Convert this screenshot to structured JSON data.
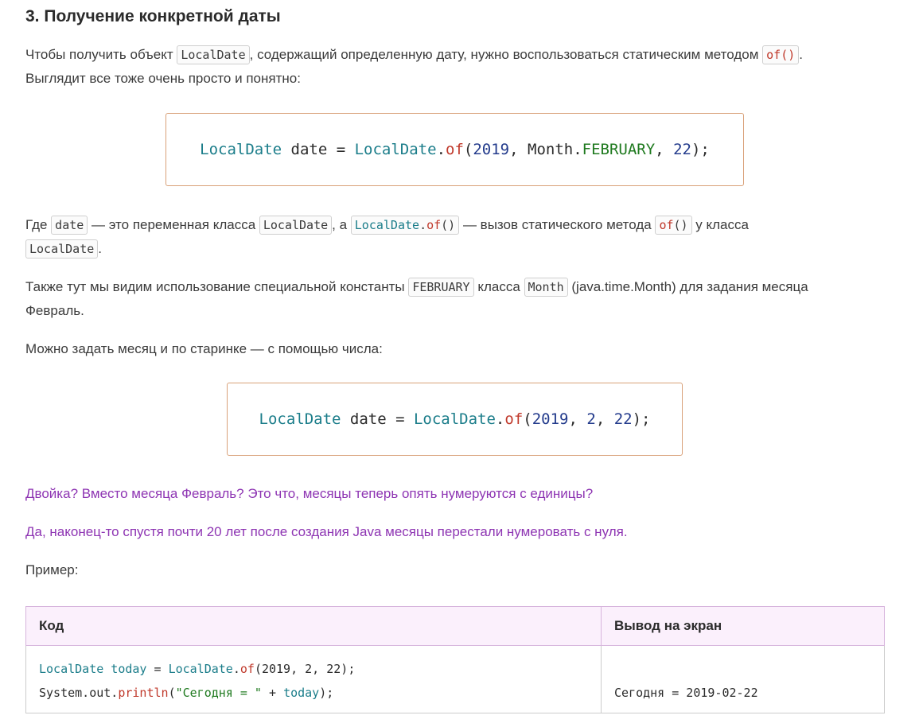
{
  "section": {
    "title": "3. Получение конкретной даты"
  },
  "intro": {
    "text_1": "Чтобы получить объект ",
    "code_localdate": "LocalDate",
    "text_2": ", содержащий определенную дату, нужно воспользоваться статическим методом ",
    "code_of": "of()",
    "text_3": ".",
    "line_2": "Выглядит все тоже очень просто и понятно:"
  },
  "code_block_1": {
    "type_name": "LocalDate",
    "var_name": " date = ",
    "class_ref": "LocalDate",
    "dot": ".",
    "method": "of",
    "open": "(",
    "year": "2019",
    "sep_1": ", ",
    "month_class": "Month.",
    "month_const": "FEBRUARY",
    "sep_2": ", ",
    "day": "22",
    "close": ");"
  },
  "explanation": {
    "text_1": "Где ",
    "code_date": "date",
    "text_2": " — это переменная класса ",
    "code_localdate": "LocalDate",
    "text_3": ", а ",
    "code_call_class": "LocalDate",
    "code_call_dot": ".",
    "code_call_method": "of",
    "code_call_parens": "()",
    "text_4": " — вызов статического метода ",
    "code_of_method": "of",
    "code_of_parens": "()",
    "text_5": " у класса",
    "code_localdate_2": "LocalDate",
    "text_6": "."
  },
  "constant_note": {
    "text_1": "Также тут мы видим использование специальной константы ",
    "code_february": "FEBRUARY",
    "text_2": " класса ",
    "code_month": "Month",
    "text_3": " (java.time.Month) для задания месяца",
    "line_2": "Февраль."
  },
  "numeric_month_note": {
    "text": "Можно задать месяц и по старинке — с помощью числа:"
  },
  "code_block_2": {
    "type_name": "LocalDate",
    "var_name": " date = ",
    "class_ref": "LocalDate",
    "dot": ".",
    "method": "of",
    "open": "(",
    "year": "2019",
    "sep_1": ", ",
    "month": "2",
    "sep_2": ", ",
    "day": "22",
    "close": ");"
  },
  "question": {
    "text": "Двойка? Вместо месяца Февраль? Это что, месяцы теперь опять нумеруются с единицы?"
  },
  "answer": {
    "text": "Да, наконец-то спустя почти 20 лет после создания Java месяцы перестали нумеровать с нуля."
  },
  "example": {
    "label": "Пример:",
    "headers": {
      "code": "Код",
      "output": "Вывод на экран"
    },
    "line_1": {
      "type_name": "LocalDate",
      "var": " today",
      "eq": " = ",
      "class_ref": "LocalDate",
      "dot": ".",
      "method": "of",
      "args": "(2019, 2, 22);"
    },
    "line_2": {
      "prefix": "System.out.",
      "method": "println",
      "open": "(",
      "string": "\"Сегодня = \"",
      "plus": " + ",
      "var": "today",
      "close": ");"
    },
    "output": "Сегодня = 2019-02-22"
  }
}
